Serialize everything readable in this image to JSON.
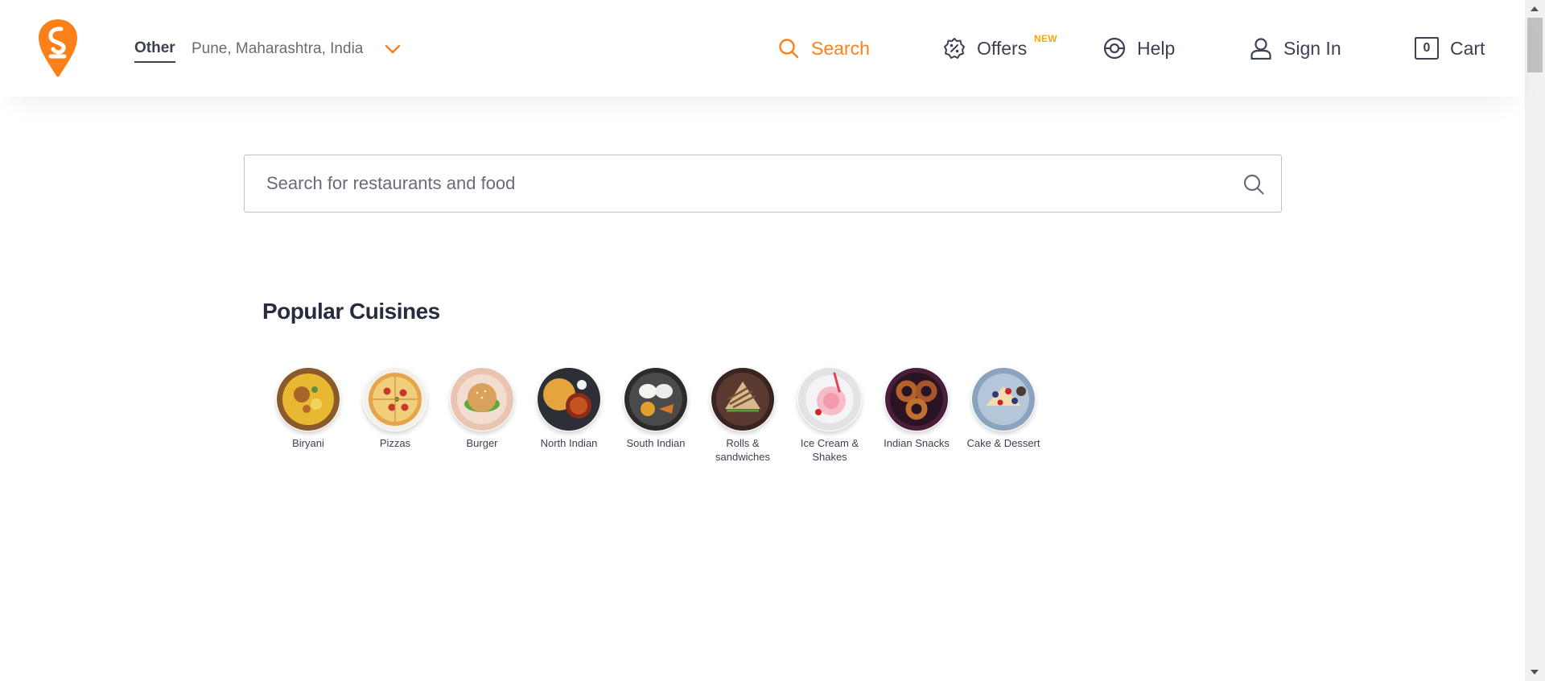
{
  "header": {
    "location_type": "Other",
    "location_text": "Pune, Maharashtra, India",
    "nav": {
      "search": "Search",
      "offers": "Offers",
      "offers_badge": "NEW",
      "help": "Help",
      "sign_in": "Sign In",
      "cart": "Cart",
      "cart_count": "0"
    }
  },
  "search": {
    "placeholder": "Search for restaurants and food"
  },
  "popular": {
    "title": "Popular Cuisines",
    "items": [
      {
        "label": "Biryani",
        "icon": "biryani-icon"
      },
      {
        "label": "Pizzas",
        "icon": "pizza-icon"
      },
      {
        "label": "Burger",
        "icon": "burger-icon"
      },
      {
        "label": "North Indian",
        "icon": "north-indian-icon"
      },
      {
        "label": "South Indian",
        "icon": "south-indian-icon"
      },
      {
        "label": "Rolls & sandwiches",
        "icon": "sandwich-icon"
      },
      {
        "label": "Ice Cream & Shakes",
        "icon": "ice-cream-icon"
      },
      {
        "label": "Indian Snacks",
        "icon": "snacks-icon"
      },
      {
        "label": "Cake & Dessert",
        "icon": "cake-icon"
      }
    ]
  },
  "colors": {
    "brand": "#fc8019",
    "text": "#3d4152",
    "badge": "#ffa700"
  }
}
